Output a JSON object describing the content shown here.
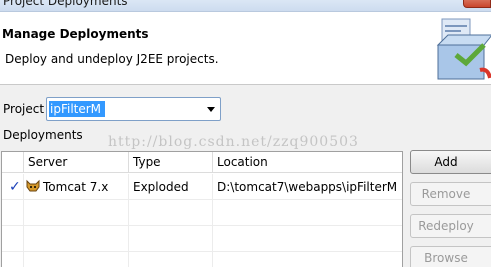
{
  "window": {
    "title": "Project Deployments"
  },
  "banner": {
    "heading": "Manage Deployments",
    "description": "Deploy and undeploy J2EE projects."
  },
  "project": {
    "label": "Project",
    "selected": "ipFilterM"
  },
  "deployments": {
    "label": "Deployments",
    "columns": [
      "Server",
      "Type",
      "Location"
    ],
    "rows": [
      {
        "checked": "✓",
        "server": "Tomcat  7.x",
        "type": "Exploded",
        "location": "D:\\tomcat7\\webapps\\ipFilterM"
      }
    ]
  },
  "buttons": {
    "add": "Add",
    "remove": "Remove",
    "redeploy": "Redeploy",
    "browse": "Browse"
  },
  "watermark": "http://blog.csdn.net/zzq900503",
  "colors": {
    "selection": "#3399ff",
    "check": "#1a3fb8"
  }
}
